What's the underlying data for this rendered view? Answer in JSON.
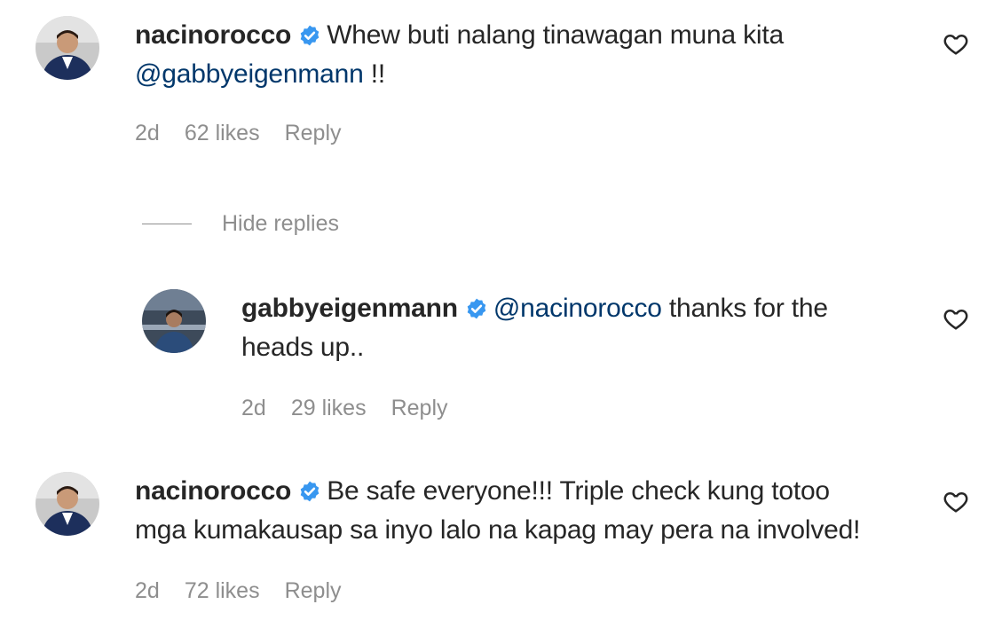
{
  "comments": [
    {
      "username": "nacinorocco",
      "text_line1": "Whew buti nalang tinawagan muna kita",
      "mention": "@gabbyeigenmann",
      "text_after_mention": " !!",
      "time": "2d",
      "likes": "62 likes",
      "reply_label": "Reply"
    },
    {
      "username": "gabbyeigenmann",
      "mention": "@nacinorocco",
      "text_line1": " thanks for the",
      "text_line2": "heads up..",
      "time": "2d",
      "likes": "29 likes",
      "reply_label": "Reply"
    },
    {
      "username": "nacinorocco",
      "text_line1": "Be safe everyone!!! Triple check kung totoo",
      "text_line2": "mga kumakausap sa inyo lalo na kapag may pera na involved!",
      "time": "2d",
      "likes": "72 likes",
      "reply_label": "Reply"
    }
  ],
  "replies_toggle": {
    "label": "Hide replies"
  },
  "colors": {
    "verified": "#3897f0",
    "mention": "#00376b",
    "meta": "#8e8e8e",
    "text": "#262626"
  },
  "icons": {
    "verified": "verified-badge-icon",
    "like": "heart-icon"
  }
}
